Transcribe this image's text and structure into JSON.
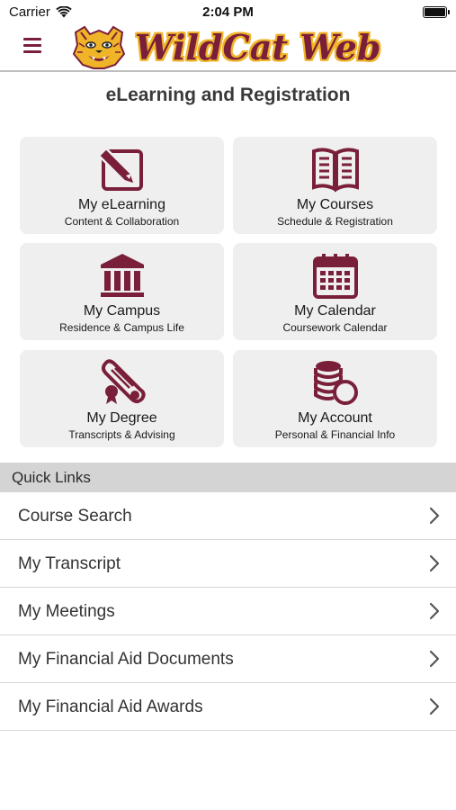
{
  "status_bar": {
    "carrier": "Carrier",
    "time": "2:04 PM",
    "battery_level": 1.0
  },
  "header": {
    "logo_text": "WildCat Web",
    "menu_icon": "hamburger-icon",
    "colors": {
      "brand": "#7a1f3a",
      "gold": "#f0b429"
    }
  },
  "page": {
    "title": "eLearning and Registration"
  },
  "tiles": [
    {
      "title": "My eLearning",
      "subtitle": "Content & Collaboration",
      "icon": "pencil-note-icon"
    },
    {
      "title": "My Courses",
      "subtitle": "Schedule & Registration",
      "icon": "open-book-icon"
    },
    {
      "title": "My Campus",
      "subtitle": "Residence & Campus Life",
      "icon": "building-columns-icon"
    },
    {
      "title": "My Calendar",
      "subtitle": "Coursework Calendar",
      "icon": "calendar-icon"
    },
    {
      "title": "My Degree",
      "subtitle": "Transcripts & Advising",
      "icon": "diploma-scroll-icon"
    },
    {
      "title": "My Account",
      "subtitle": "Personal & Financial Info",
      "icon": "coins-icon"
    }
  ],
  "quick_links": {
    "header": "Quick Links",
    "items": [
      {
        "label": "Course Search"
      },
      {
        "label": "My Transcript"
      },
      {
        "label": "My Meetings"
      },
      {
        "label": "My Financial Aid Documents"
      },
      {
        "label": "My Financial Aid Awards"
      }
    ]
  }
}
